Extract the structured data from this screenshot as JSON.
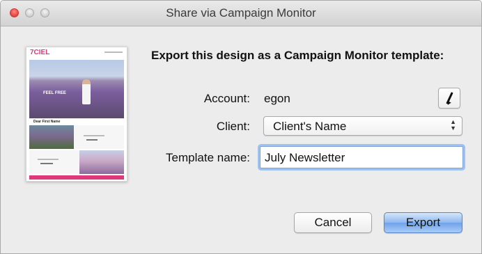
{
  "window": {
    "title": "Share via Campaign Monitor"
  },
  "thumbnail": {
    "logo": "7CIEL",
    "hero_text": "FEEL FREE",
    "greeting": "Dear First Name"
  },
  "form": {
    "heading": "Export this design as a Campaign Monitor template:",
    "account_label": "Account:",
    "account_value": "egon",
    "client_label": "Client:",
    "client_selected": "Client's Name",
    "template_name_label": "Template name:",
    "template_name_value": "July Newsletter"
  },
  "buttons": {
    "cancel_label": "Cancel",
    "export_label": "Export"
  },
  "colors": {
    "close_light": "#e0443e",
    "focus_ring": "#9ec1f0",
    "default_button": "#6fa3ea",
    "thumb_accent": "#e0397b"
  },
  "icons": {
    "edit": "pencil-icon",
    "select": "chevron-up-down-icon"
  }
}
